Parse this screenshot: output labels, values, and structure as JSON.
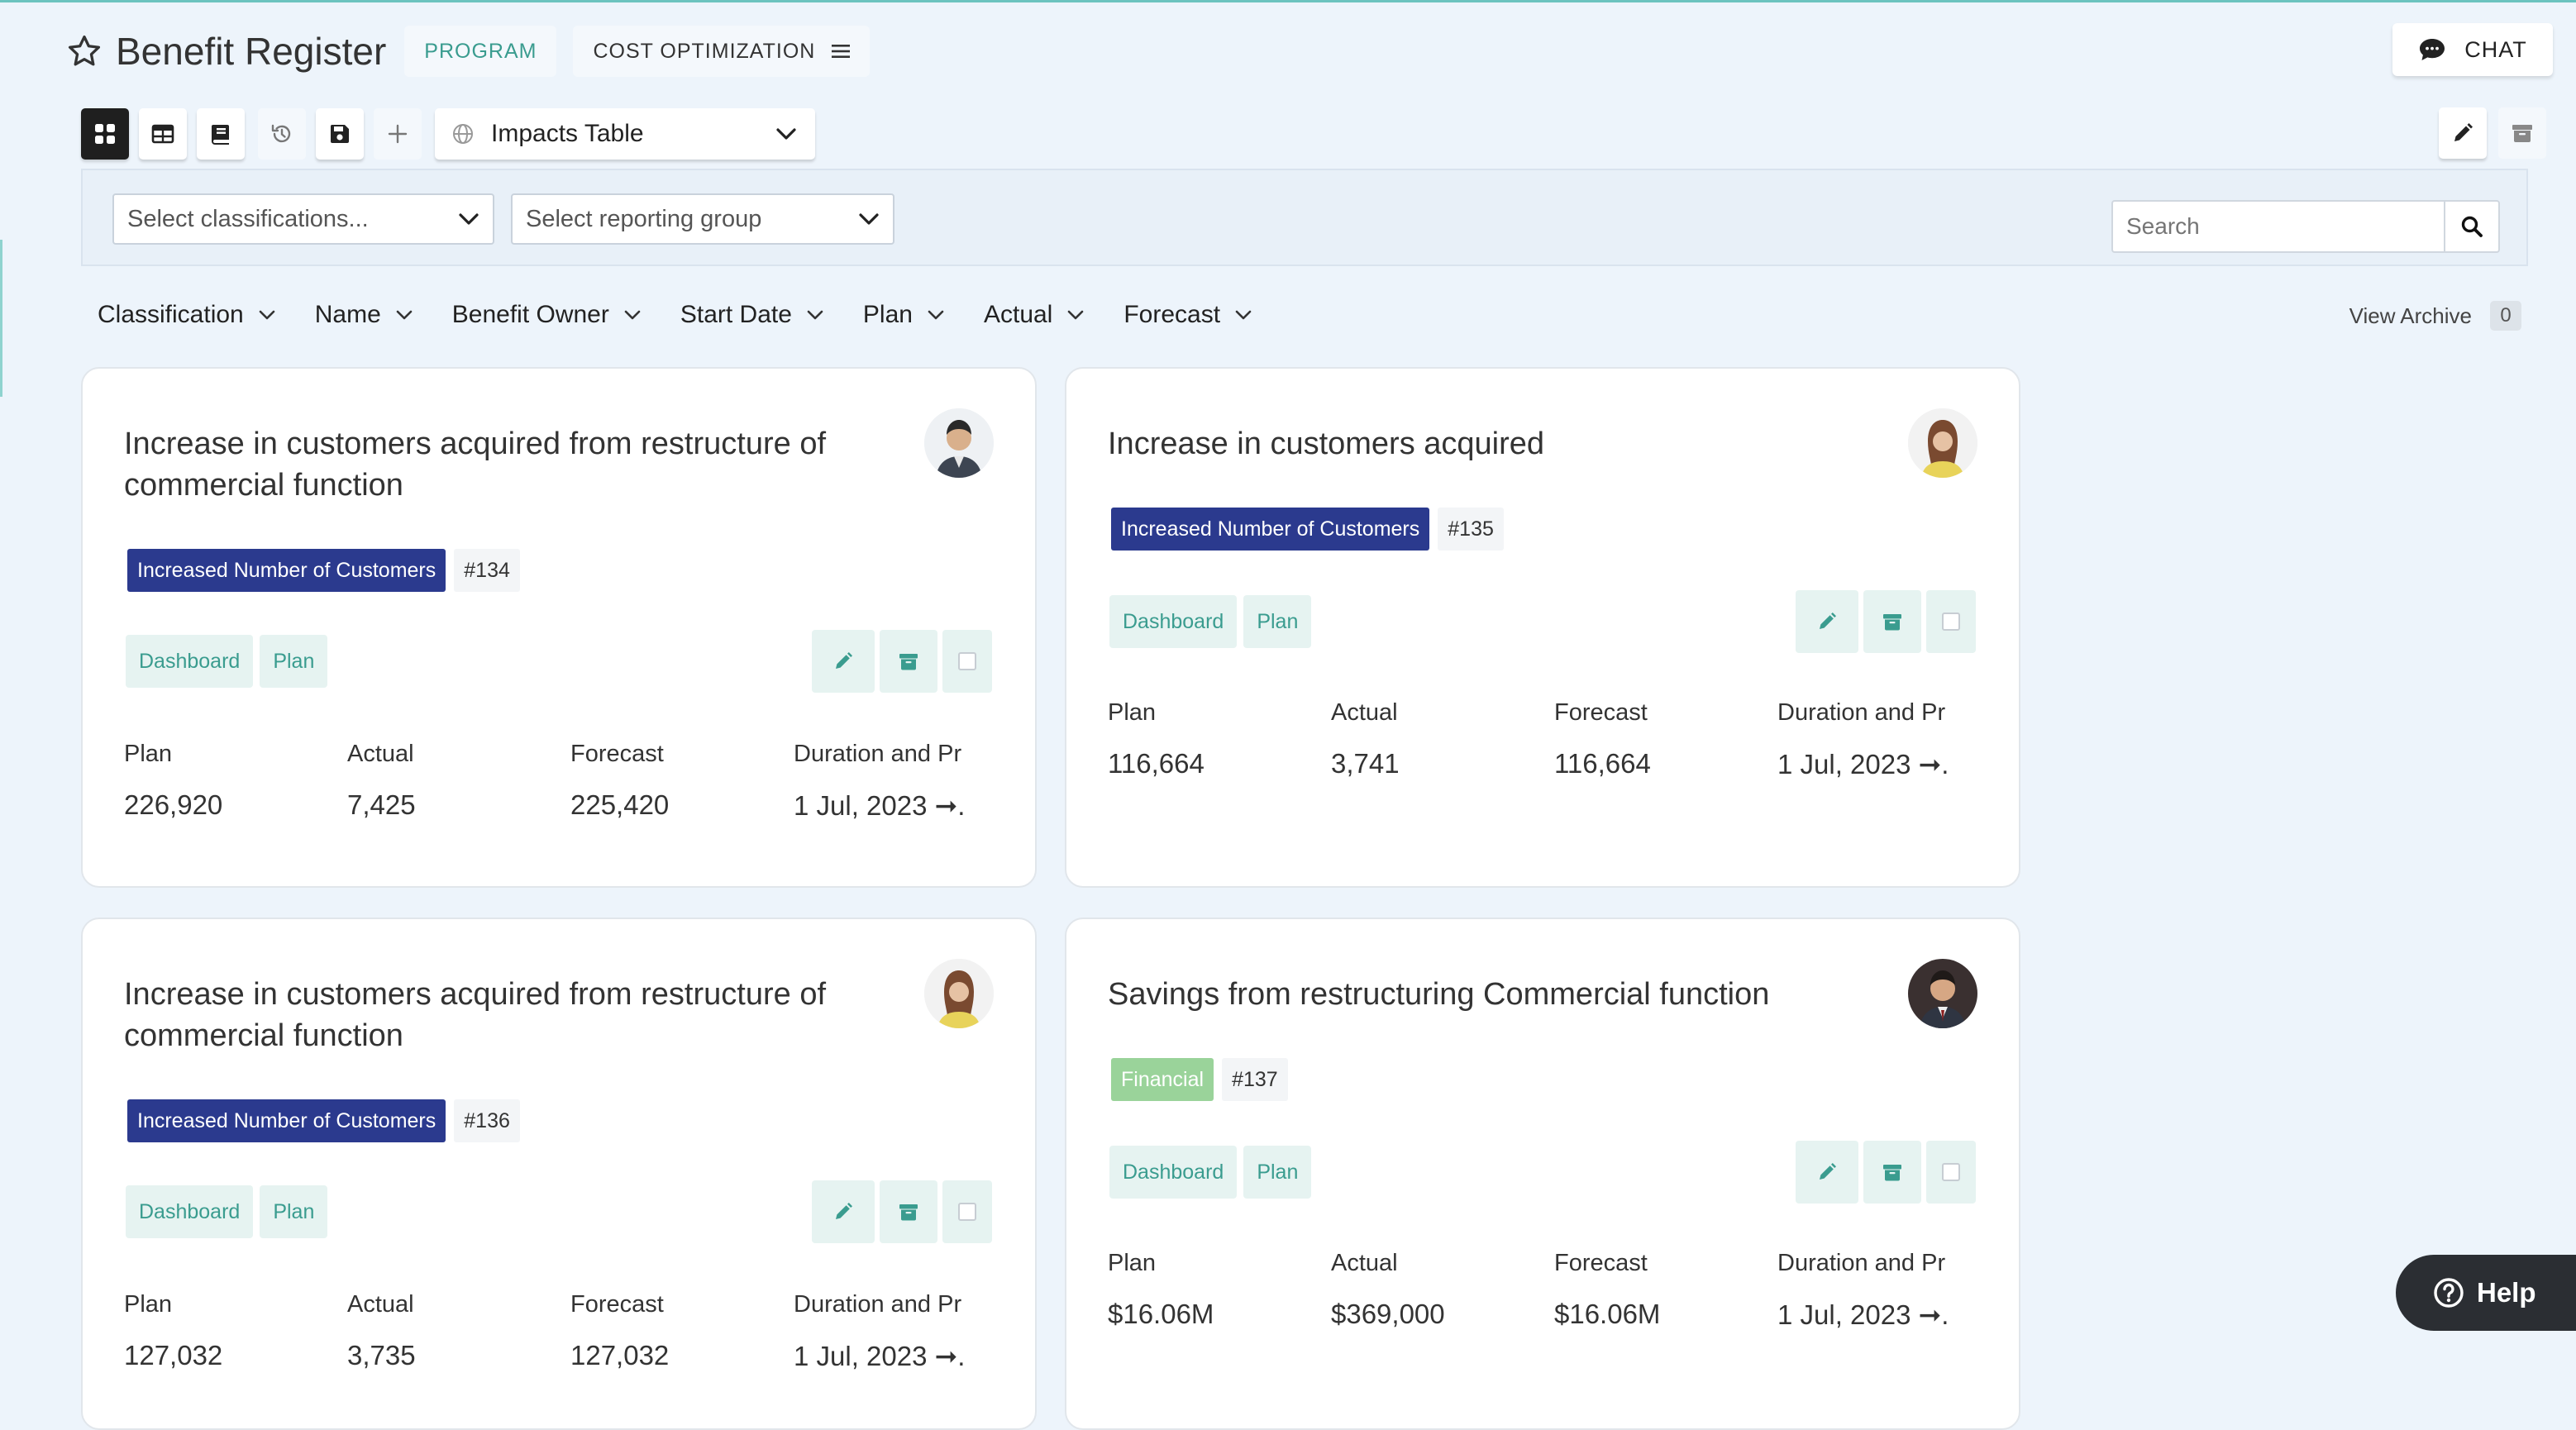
{
  "header": {
    "title": "Benefit Register",
    "program_label": "PROGRAM",
    "cost_label": "COST OPTIMIZATION",
    "chat_label": "CHAT"
  },
  "toolbar": {
    "view_select": "Impacts Table"
  },
  "filters": {
    "classifications_placeholder": "Select classifications...",
    "reporting_group_placeholder": "Select reporting group",
    "search_placeholder": "Search"
  },
  "sort_fields": [
    "Classification",
    "Name",
    "Benefit Owner",
    "Start Date",
    "Plan",
    "Actual",
    "Forecast"
  ],
  "archive": {
    "label": "View Archive",
    "count": "0"
  },
  "cards": [
    {
      "title": "Increase in customers acquired from restructure of commercial function",
      "classification": "Increased Number of Customers",
      "id": "#134",
      "chips": [
        "Dashboard",
        "Plan"
      ],
      "plan_label": "Plan",
      "plan": "226,920",
      "actual_label": "Actual",
      "actual": "7,425",
      "forecast_label": "Forecast",
      "forecast": "225,420",
      "duration_label": "Duration and Pr",
      "duration": "1 Jul, 2023 ➞..."
    },
    {
      "title": "Increase in customers acquired",
      "classification": "Increased Number of Customers",
      "id": "#135",
      "chips": [
        "Dashboard",
        "Plan"
      ],
      "plan_label": "Plan",
      "plan": "116,664",
      "actual_label": "Actual",
      "actual": "3,741",
      "forecast_label": "Forecast",
      "forecast": "116,664",
      "duration_label": "Duration and Pr",
      "duration": "1 Jul, 2023 ➞..."
    },
    {
      "title": "Increase in customers acquired from restructure of commercial function",
      "classification": "Increased Number of Customers",
      "id": "#136",
      "chips": [
        "Dashboard",
        "Plan"
      ],
      "plan_label": "Plan",
      "plan": "127,032",
      "actual_label": "Actual",
      "actual": "3,735",
      "forecast_label": "Forecast",
      "forecast": "127,032",
      "duration_label": "Duration and Pr",
      "duration": "1 Jul, 2023 ➞..."
    },
    {
      "title": "Savings from restructuring Commercial function",
      "classification": "Financial",
      "id": "#137",
      "chips": [
        "Dashboard",
        "Plan"
      ],
      "plan_label": "Plan",
      "plan": "$16.06M",
      "actual_label": "Actual",
      "actual": "$369,000",
      "forecast_label": "Forecast",
      "forecast": "$16.06M",
      "duration_label": "Duration and Pr",
      "duration": "1 Jul, 2023 ➞..."
    }
  ],
  "help": {
    "label": "Help"
  },
  "colors": {
    "accent": "#3a9c8f",
    "classification_blue": "#2b3a8e",
    "classification_green": "#9ad39a",
    "background": "#edf4fb"
  }
}
